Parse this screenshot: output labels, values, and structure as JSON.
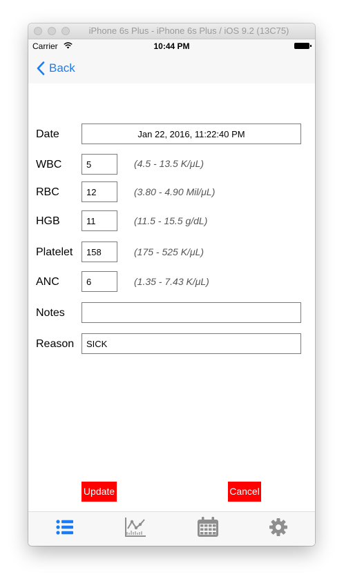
{
  "window": {
    "title": "iPhone 6s Plus - iPhone 6s Plus / iOS 9.2 (13C75)"
  },
  "status_bar": {
    "carrier": "Carrier",
    "time": "10:44 PM"
  },
  "nav": {
    "back_label": "Back"
  },
  "form": {
    "date": {
      "label": "Date",
      "value": "Jan 22, 2016, 11:22:40 PM"
    },
    "wbc": {
      "label": "WBC",
      "value": "5",
      "range": "(4.5 - 13.5 K/μL)"
    },
    "rbc": {
      "label": "RBC",
      "value": "12",
      "range": "(3.80 - 4.90 Mil/μL)"
    },
    "hgb": {
      "label": "HGB",
      "value": "11",
      "range": "(11.5 - 15.5 g/dL)"
    },
    "platelet": {
      "label": "Platelet",
      "value": "158",
      "range": "(175 - 525 K/μL)"
    },
    "anc": {
      "label": "ANC",
      "value": "6",
      "range": "(1.35 - 7.43 K/μL)"
    },
    "notes": {
      "label": "Notes",
      "value": ""
    },
    "reason": {
      "label": "Reason",
      "value": "SICK"
    }
  },
  "actions": {
    "update_label": "Update",
    "cancel_label": "Cancel"
  },
  "tab_bar": {
    "tabs": [
      {
        "icon": "list-icon",
        "active": true
      },
      {
        "icon": "chart-icon",
        "active": false
      },
      {
        "icon": "calendar-icon",
        "active": false
      },
      {
        "icon": "gear-icon",
        "active": false
      }
    ]
  },
  "colors": {
    "accent": "#1a7cf5",
    "button_bg": "#ff0000",
    "inactive_icon": "#8e8e8e"
  }
}
